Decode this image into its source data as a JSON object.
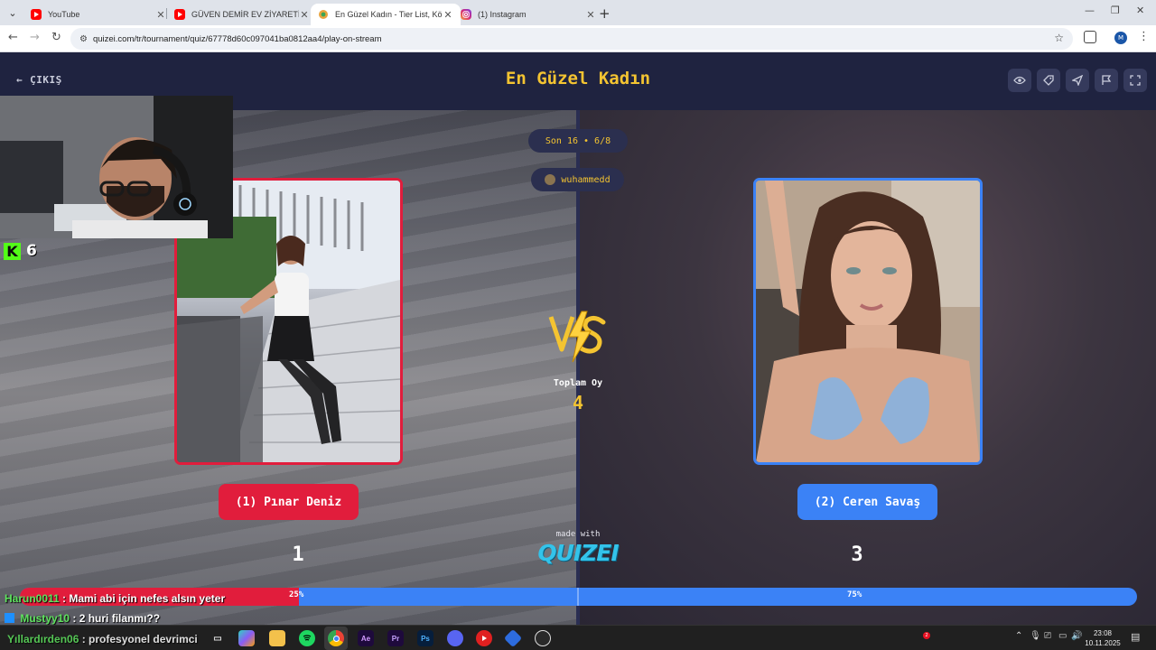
{
  "browser": {
    "tabs": [
      {
        "title": "YouTube",
        "favicon": "youtube-icon",
        "color": "#ff0000",
        "active": false
      },
      {
        "title": "GÜVEN DEMİR EV ZİYARETİ - YouTube",
        "favicon": "youtube-icon",
        "color": "#ff0000",
        "active": false
      },
      {
        "title": "En Güzel Kadın - Tier List, Kör Sıralama",
        "favicon": "quizei-icon",
        "color": "#e8a33d",
        "active": true
      },
      {
        "title": "(1) Instagram",
        "favicon": "instagram-icon",
        "color": "#d62976",
        "active": false
      }
    ],
    "new_tab": "+",
    "url": "quizei.com/tr/tournament/quiz/67778d60c097041ba0812aa4/play-on-stream",
    "profile_initial": "M"
  },
  "header": {
    "exit_label": "ÇIKIŞ",
    "title": "En Güzel Kadın",
    "tools": [
      "eye-icon",
      "tag-icon",
      "send-icon",
      "flag-icon",
      "fullscreen-icon"
    ]
  },
  "round": {
    "label": "Son 16 • 6/8",
    "player": "wuhammedd"
  },
  "matchup": {
    "left": {
      "name": "(1) Pınar Deniz",
      "votes": "1",
      "color": "#e11d3c"
    },
    "right": {
      "name": "(2) Ceren Savaş",
      "votes": "3",
      "color": "#3b82f6"
    },
    "vs_label": "VS",
    "total_label": "Toplam Oy",
    "total_value": "4"
  },
  "results_bar": {
    "left_pct_label": "25%",
    "right_pct_label": "75%",
    "left_fraction": 0.25
  },
  "branding": {
    "made_with": "made with",
    "logo": "QUIZEI"
  },
  "stream": {
    "viewer_count": "6",
    "chat": [
      {
        "user": "Harun0011",
        "message": ": Mami abi için nefes alsın yeter",
        "kick_icon": false
      },
      {
        "user": "Mustyy10",
        "message": ": 2 huri filanmı??",
        "kick_icon": true
      },
      {
        "user": "Yıllardırden06",
        "message": ": profesyonel devrimci",
        "kick_icon": false
      }
    ]
  },
  "taskbar": {
    "apps": [
      "windows-icon",
      "search-icon",
      "task-view-icon",
      "copilot-icon",
      "file-explorer-icon",
      "spotify-icon",
      "chrome-icon",
      "after-effects-icon",
      "premiere-icon",
      "photoshop-icon",
      "discord-icon",
      "youtube-music-icon",
      "app-icon",
      "obs-icon"
    ],
    "app_labels": {
      "ae": "Ae",
      "pr": "Pr",
      "ps": "Ps"
    },
    "notification_count": "2",
    "time": "23:08",
    "date": "10.11.2025"
  }
}
